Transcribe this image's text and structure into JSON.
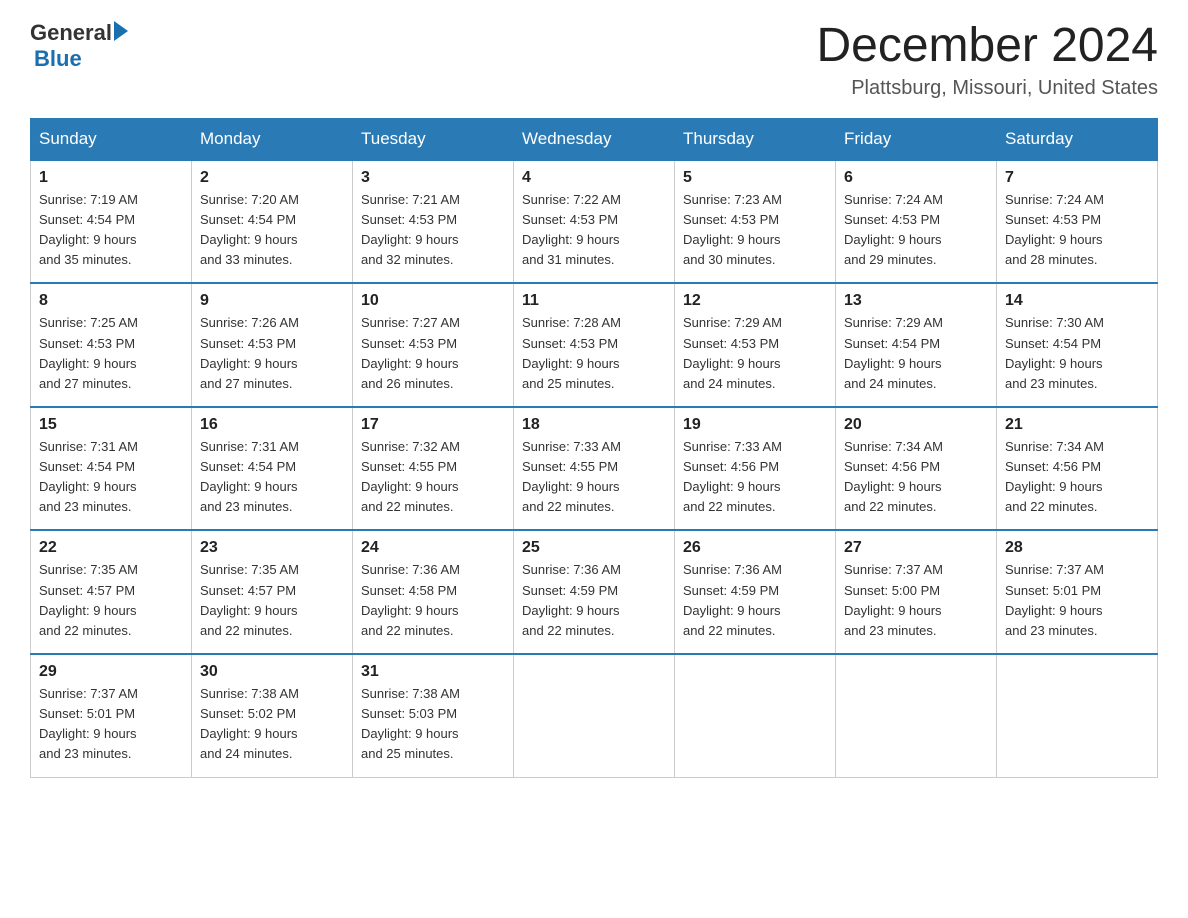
{
  "logo": {
    "general": "General",
    "blue": "Blue"
  },
  "title": "December 2024",
  "subtitle": "Plattsburg, Missouri, United States",
  "days_of_week": [
    "Sunday",
    "Monday",
    "Tuesday",
    "Wednesday",
    "Thursday",
    "Friday",
    "Saturday"
  ],
  "weeks": [
    [
      {
        "day": "1",
        "sunrise": "7:19 AM",
        "sunset": "4:54 PM",
        "daylight": "9 hours and 35 minutes."
      },
      {
        "day": "2",
        "sunrise": "7:20 AM",
        "sunset": "4:54 PM",
        "daylight": "9 hours and 33 minutes."
      },
      {
        "day": "3",
        "sunrise": "7:21 AM",
        "sunset": "4:53 PM",
        "daylight": "9 hours and 32 minutes."
      },
      {
        "day": "4",
        "sunrise": "7:22 AM",
        "sunset": "4:53 PM",
        "daylight": "9 hours and 31 minutes."
      },
      {
        "day": "5",
        "sunrise": "7:23 AM",
        "sunset": "4:53 PM",
        "daylight": "9 hours and 30 minutes."
      },
      {
        "day": "6",
        "sunrise": "7:24 AM",
        "sunset": "4:53 PM",
        "daylight": "9 hours and 29 minutes."
      },
      {
        "day": "7",
        "sunrise": "7:24 AM",
        "sunset": "4:53 PM",
        "daylight": "9 hours and 28 minutes."
      }
    ],
    [
      {
        "day": "8",
        "sunrise": "7:25 AM",
        "sunset": "4:53 PM",
        "daylight": "9 hours and 27 minutes."
      },
      {
        "day": "9",
        "sunrise": "7:26 AM",
        "sunset": "4:53 PM",
        "daylight": "9 hours and 27 minutes."
      },
      {
        "day": "10",
        "sunrise": "7:27 AM",
        "sunset": "4:53 PM",
        "daylight": "9 hours and 26 minutes."
      },
      {
        "day": "11",
        "sunrise": "7:28 AM",
        "sunset": "4:53 PM",
        "daylight": "9 hours and 25 minutes."
      },
      {
        "day": "12",
        "sunrise": "7:29 AM",
        "sunset": "4:53 PM",
        "daylight": "9 hours and 24 minutes."
      },
      {
        "day": "13",
        "sunrise": "7:29 AM",
        "sunset": "4:54 PM",
        "daylight": "9 hours and 24 minutes."
      },
      {
        "day": "14",
        "sunrise": "7:30 AM",
        "sunset": "4:54 PM",
        "daylight": "9 hours and 23 minutes."
      }
    ],
    [
      {
        "day": "15",
        "sunrise": "7:31 AM",
        "sunset": "4:54 PM",
        "daylight": "9 hours and 23 minutes."
      },
      {
        "day": "16",
        "sunrise": "7:31 AM",
        "sunset": "4:54 PM",
        "daylight": "9 hours and 23 minutes."
      },
      {
        "day": "17",
        "sunrise": "7:32 AM",
        "sunset": "4:55 PM",
        "daylight": "9 hours and 22 minutes."
      },
      {
        "day": "18",
        "sunrise": "7:33 AM",
        "sunset": "4:55 PM",
        "daylight": "9 hours and 22 minutes."
      },
      {
        "day": "19",
        "sunrise": "7:33 AM",
        "sunset": "4:56 PM",
        "daylight": "9 hours and 22 minutes."
      },
      {
        "day": "20",
        "sunrise": "7:34 AM",
        "sunset": "4:56 PM",
        "daylight": "9 hours and 22 minutes."
      },
      {
        "day": "21",
        "sunrise": "7:34 AM",
        "sunset": "4:56 PM",
        "daylight": "9 hours and 22 minutes."
      }
    ],
    [
      {
        "day": "22",
        "sunrise": "7:35 AM",
        "sunset": "4:57 PM",
        "daylight": "9 hours and 22 minutes."
      },
      {
        "day": "23",
        "sunrise": "7:35 AM",
        "sunset": "4:57 PM",
        "daylight": "9 hours and 22 minutes."
      },
      {
        "day": "24",
        "sunrise": "7:36 AM",
        "sunset": "4:58 PM",
        "daylight": "9 hours and 22 minutes."
      },
      {
        "day": "25",
        "sunrise": "7:36 AM",
        "sunset": "4:59 PM",
        "daylight": "9 hours and 22 minutes."
      },
      {
        "day": "26",
        "sunrise": "7:36 AM",
        "sunset": "4:59 PM",
        "daylight": "9 hours and 22 minutes."
      },
      {
        "day": "27",
        "sunrise": "7:37 AM",
        "sunset": "5:00 PM",
        "daylight": "9 hours and 23 minutes."
      },
      {
        "day": "28",
        "sunrise": "7:37 AM",
        "sunset": "5:01 PM",
        "daylight": "9 hours and 23 minutes."
      }
    ],
    [
      {
        "day": "29",
        "sunrise": "7:37 AM",
        "sunset": "5:01 PM",
        "daylight": "9 hours and 23 minutes."
      },
      {
        "day": "30",
        "sunrise": "7:38 AM",
        "sunset": "5:02 PM",
        "daylight": "9 hours and 24 minutes."
      },
      {
        "day": "31",
        "sunrise": "7:38 AM",
        "sunset": "5:03 PM",
        "daylight": "9 hours and 25 minutes."
      },
      null,
      null,
      null,
      null
    ]
  ],
  "labels": {
    "sunrise": "Sunrise:",
    "sunset": "Sunset:",
    "daylight": "Daylight:"
  }
}
